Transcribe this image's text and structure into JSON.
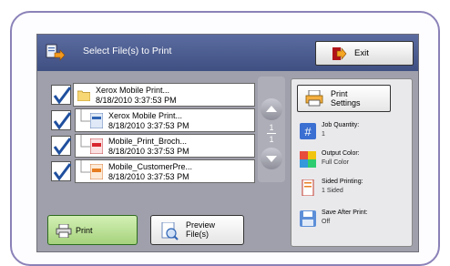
{
  "header": {
    "title": "Select File(s) to Print",
    "exit_label": "Exit"
  },
  "files": [
    {
      "name": "Xerox Mobile Print...",
      "date": "8/18/2010 3:37:53 PM",
      "type": "folder",
      "checked": true
    },
    {
      "name": "Xerox Mobile Print...",
      "date": "8/18/2010 3:37:53 PM",
      "type": "doc",
      "checked": true
    },
    {
      "name": "Mobile_Print_Broch...",
      "date": "8/18/2010 3:37:53 PM",
      "type": "pdf",
      "checked": true
    },
    {
      "name": "Mobile_CustomerPre...",
      "date": "8/18/2010 3:37:53 PM",
      "type": "ppt",
      "checked": true
    }
  ],
  "pager": {
    "current": "1",
    "total": "1"
  },
  "settings": {
    "button_line1": "Print",
    "button_line2": "Settings",
    "job_quantity_label": "Job Quantity:",
    "job_quantity_value": "1",
    "output_color_label": "Output Color:",
    "output_color_value": "Full Color",
    "sided_label": "Sided Printing:",
    "sided_value": "1 Sided",
    "save_label": "Save After Print:",
    "save_value": "Off"
  },
  "actions": {
    "print_label": "Print",
    "preview_line1": "Preview",
    "preview_line2": "File(s)"
  },
  "colors": {
    "titlebar": "#4a5a8e",
    "print_button": "#b8e08e",
    "bezel": "#8a82b8"
  }
}
